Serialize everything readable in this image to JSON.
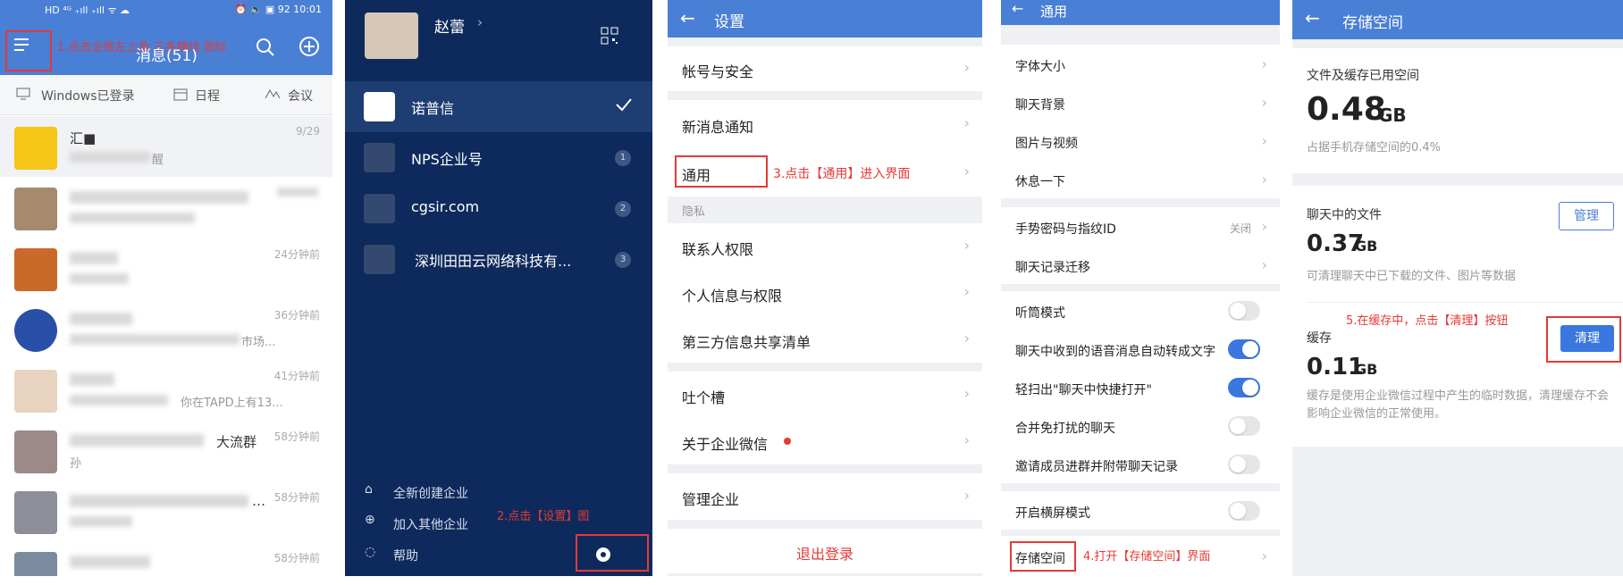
{
  "panel1": {
    "status": {
      "left_text": "HD ⁴ᴳ ₊ıll ₊ıll ᯤ ☁",
      "right_text": "⏰ 🔈 ▣ 92 10:01"
    },
    "header": {
      "title": "消息(51)",
      "annotation": "1.点击企微左上角 三条横线 图标"
    },
    "subbar": {
      "windows": "Windows已登录",
      "schedule": "日程",
      "meeting": "会议"
    },
    "chats": [
      {
        "name": "汇■",
        "msg": "醒",
        "time": "9/29"
      },
      {
        "name": "",
        "msg": "",
        "time": ""
      },
      {
        "name": "",
        "msg": "",
        "time": "24分钟前"
      },
      {
        "name": "",
        "msg": "市场...",
        "time": "36分钟前"
      },
      {
        "name": "",
        "msg": "你在TAPD上有13...",
        "time": "41分钟前"
      },
      {
        "name": "大流群",
        "msg": "孙",
        "time": "58分钟前"
      },
      {
        "name": "…",
        "msg": "",
        "time": "58分钟前"
      },
      {
        "name": "",
        "msg": "",
        "time": "58分钟前"
      }
    ]
  },
  "panel2": {
    "user": "赵蕾",
    "orgs": [
      {
        "name": "诺普信",
        "badge": ""
      },
      {
        "name": "NPS企业号",
        "badge": "1"
      },
      {
        "name": "cgsir.com",
        "badge": "2"
      },
      {
        "name": "深圳田田云网络科技有...",
        "badge": "3"
      }
    ],
    "footer": {
      "create": "全新创建企业",
      "join": "加入其他企业",
      "help": "帮助"
    },
    "annotation": "2.点击【设置】图"
  },
  "panel3": {
    "title": "设置",
    "items": {
      "account": "帐号与安全",
      "notify": "新消息通知",
      "general": "通用",
      "privacy_header": "隐私",
      "contacts": "联系人权限",
      "personal": "个人信息与权限",
      "third": "第三方信息共享清单",
      "feedback": "吐个槽",
      "about": "关于企业微信",
      "manage": "管理企业",
      "logout": "退出登录"
    },
    "annotation": "3.点击【通用】进入界面"
  },
  "panel4": {
    "title": "通用",
    "items": {
      "font": "字体大小",
      "bg": "聊天背景",
      "media": "图片与视频",
      "rest": "休息一下",
      "gesture": "手势密码与指纹ID",
      "gesture_value": "关闭",
      "migrate": "聊天记录迁移",
      "earpiece": "听筒模式",
      "voice2text": "聊天中收到的语音消息自动转成文字",
      "shake": "轻扫出\"聊天中快捷打开\"",
      "merge": "合并免打扰的聊天",
      "invite": "邀请成员进群并附带聊天记录",
      "landscape": "开启横屏模式",
      "storage": "存储空间"
    },
    "toggles": {
      "earpiece": false,
      "voice2text": true,
      "shake": true,
      "merge": false,
      "invite": false,
      "landscape": false
    },
    "annotation": "4.打开【存储空间】界面"
  },
  "panel5": {
    "title": "存储空间",
    "total": {
      "label": "文件及缓存已用空间",
      "value": "0.48",
      "unit": "GB",
      "note": "占据手机存储空间的0.4%"
    },
    "files": {
      "label": "聊天中的文件",
      "value": "0.37",
      "unit": "GB",
      "note": "可清理聊天中已下载的文件、图片等数据",
      "button": "管理"
    },
    "cache": {
      "label": "缓存",
      "value": "0.11",
      "unit": "GB",
      "note": "缓存是使用企业微信过程中产生的临时数据，清理缓存不会影响企业微信的正常使用。",
      "button": "清理"
    },
    "annotation": "5.在缓存中，点击【清理】按钮"
  },
  "colors": {
    "primary": "#4a7fd6",
    "sidebar": "#0e2a5c",
    "annotation": "#e53935",
    "toggle_on": "#3a78e0"
  }
}
